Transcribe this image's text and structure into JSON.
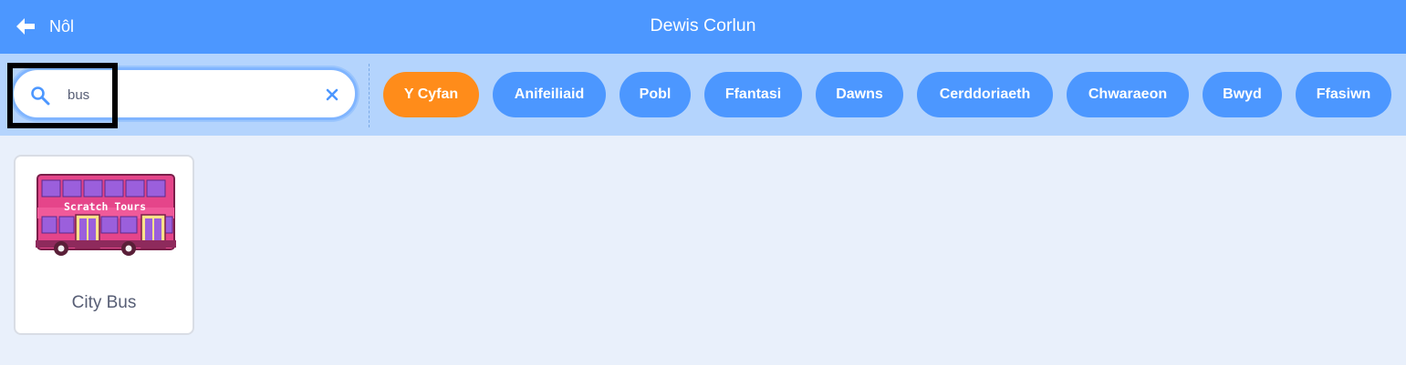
{
  "header": {
    "back_label": "Nôl",
    "title": "Dewis Corlun"
  },
  "search": {
    "value": "bus",
    "placeholder": ""
  },
  "tags": [
    {
      "label": "Y Cyfan",
      "active": true
    },
    {
      "label": "Anifeiliaid",
      "active": false
    },
    {
      "label": "Pobl",
      "active": false
    },
    {
      "label": "Ffantasi",
      "active": false
    },
    {
      "label": "Dawns",
      "active": false
    },
    {
      "label": "Cerddoriaeth",
      "active": false
    },
    {
      "label": "Chwaraeon",
      "active": false
    },
    {
      "label": "Bwyd",
      "active": false
    },
    {
      "label": "Ffasiwn",
      "active": false
    }
  ],
  "results": [
    {
      "name": "City Bus",
      "thumbnail_text": "Scratch Tours"
    }
  ],
  "colors": {
    "header": "#4c97ff",
    "filter_bar": "#b4d4fd",
    "tag": "#4c97ff",
    "tag_active": "#ff8c1a",
    "background": "#e9f0fb",
    "bus_body": "#e5458a",
    "bus_windows": "#9b5fdc"
  },
  "icons": {
    "back": "arrow-left-icon",
    "search": "search-icon",
    "clear": "close-icon"
  }
}
